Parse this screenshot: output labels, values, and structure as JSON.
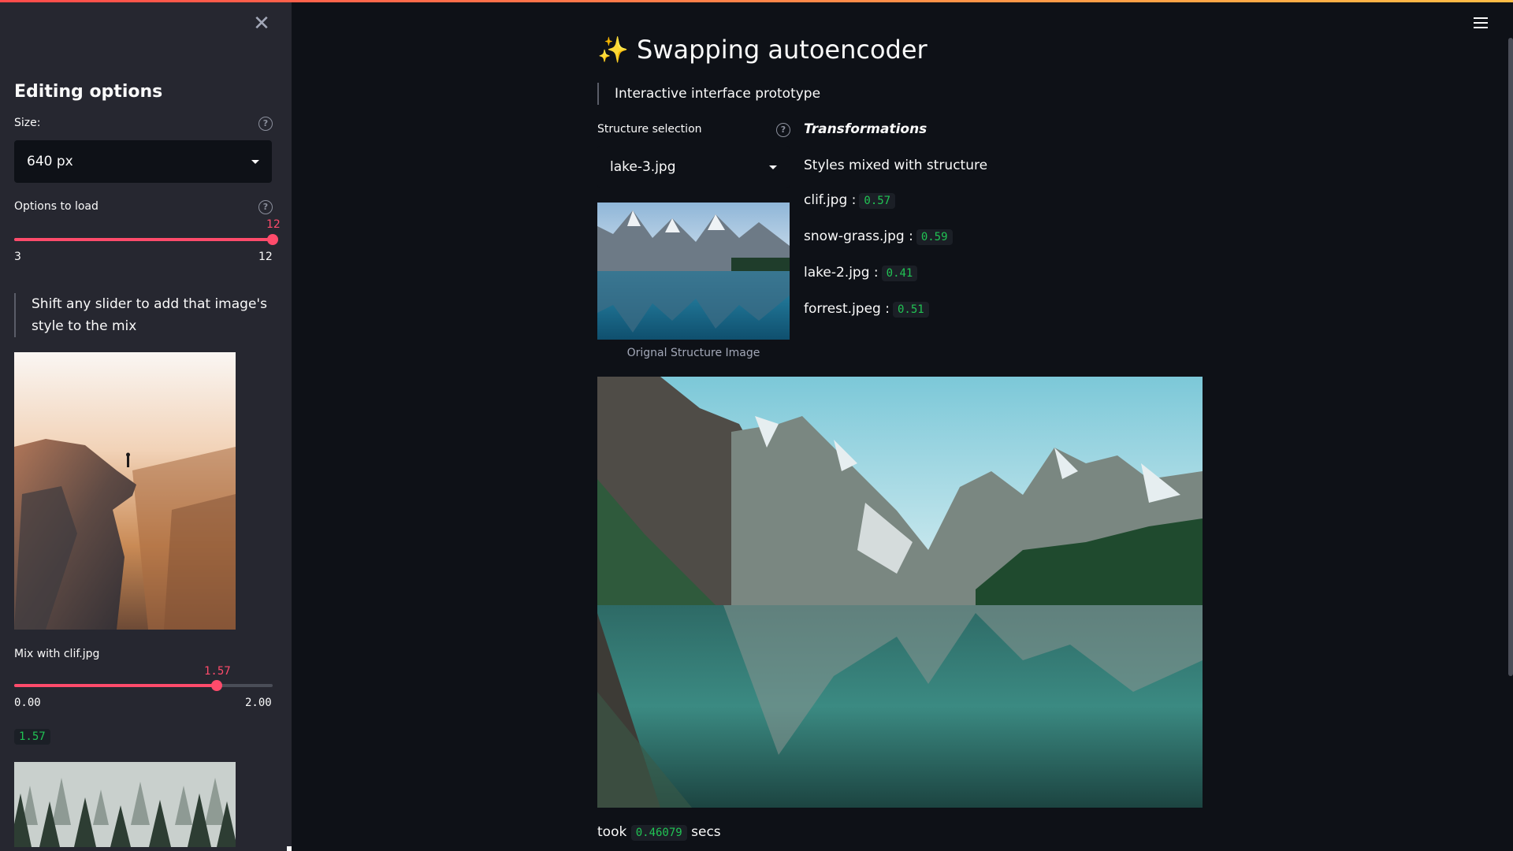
{
  "app": {
    "title_emoji": "✨",
    "title": "Swapping autoencoder",
    "subtitle": "Interactive interface prototype"
  },
  "colors": {
    "accent": "#ff4b6b",
    "code_text": "#21c354",
    "background": "#0e1117",
    "sidebar_bg": "#262730"
  },
  "sidebar": {
    "close_icon": "close-icon",
    "heading": "Editing options",
    "size": {
      "label": "Size:",
      "value": "640 px"
    },
    "options_to_load": {
      "label": "Options to load",
      "value": "12",
      "min": "3",
      "max": "12",
      "fraction": 1.0
    },
    "info_text": "Shift any slider to add that image's style to the mix",
    "mix_clif": {
      "label": "Mix with clif.jpg",
      "value": "1.57",
      "min": "0.00",
      "max": "2.00",
      "fraction": 0.785,
      "code_value": "1.57"
    }
  },
  "main": {
    "structure": {
      "label": "Structure selection",
      "value": "lake-3.jpg",
      "caption": "Orignal Structure Image"
    },
    "transformations": {
      "heading": "Transformations",
      "subheading": "Styles mixed with structure",
      "items": [
        {
          "name": "clif.jpg :",
          "value": "0.57"
        },
        {
          "name": "snow-grass.jpg :",
          "value": "0.59"
        },
        {
          "name": "lake-2.jpg :",
          "value": "0.41"
        },
        {
          "name": "forrest.jpeg :",
          "value": "0.51"
        }
      ]
    },
    "timing": {
      "prefix": "took",
      "value": "0.46079",
      "suffix": "secs"
    }
  }
}
